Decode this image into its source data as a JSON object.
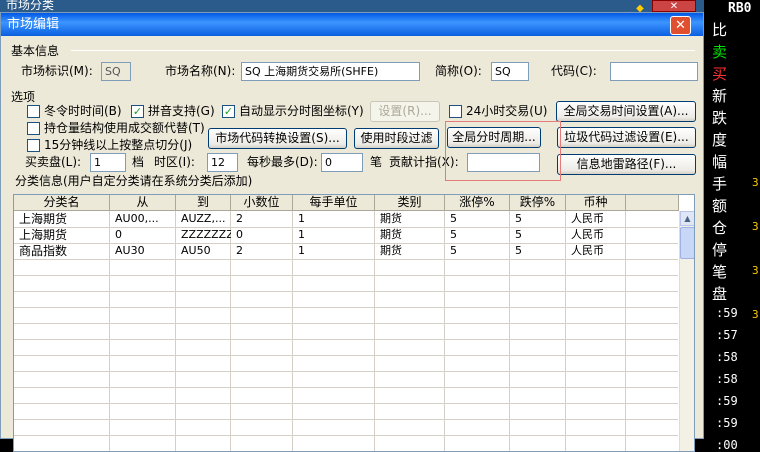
{
  "outer": {
    "title": "市场分类",
    "close": "✕"
  },
  "right_panel": {
    "header": "RB0",
    "side_chars": [
      {
        "t": "比",
        "c": "#ffffff"
      },
      {
        "t": "卖",
        "c": "#00e000"
      },
      {
        "t": "买",
        "c": "#ff3030"
      },
      {
        "t": "新",
        "c": "#ffffff"
      },
      {
        "t": "跌",
        "c": "#ffffff"
      },
      {
        "t": "度",
        "c": "#ffffff"
      },
      {
        "t": "幅",
        "c": "#ffffff"
      },
      {
        "t": "手",
        "c": "#ffffff"
      },
      {
        "t": "额",
        "c": "#ffffff"
      },
      {
        "t": "仓",
        "c": "#ffffff"
      },
      {
        "t": "停",
        "c": "#ffffff"
      },
      {
        "t": "笔",
        "c": "#ffffff"
      },
      {
        "t": "盘",
        "c": "#ffffff"
      }
    ],
    "values": [
      "3",
      "3",
      "3",
      "3"
    ],
    "times": [
      ":59",
      ":57",
      ":58",
      ":58",
      ":59",
      ":59",
      ":00"
    ]
  },
  "dialog": {
    "title": "市场编辑",
    "basic_section": "基本信息",
    "market_id_label": "市场标识(M):",
    "market_id_value": "SQ",
    "market_name_label": "市场名称(N):",
    "market_name_value": "SQ 上海期货交易所(SHFE)",
    "short_label": "简称(O):",
    "short_value": "SQ",
    "code_label": "代码(C):",
    "code_value": "",
    "options_section": "选项",
    "chk_winter": "冬令时时间(B)",
    "chk_pinyin": "拼音支持(G)",
    "chk_auto_axis": "自动显示分时图坐标(Y)",
    "btn_settings": "设置(R)...",
    "chk_24h": "24小时交易(U)",
    "btn_global_time": "全局交易时间设置(A)...",
    "chk_position": "持仓量结构使用成交额代替(T)",
    "chk_15min": "15分钟线以上按整点切分(J)",
    "btn_code_convert": "市场代码转换设置(S)...",
    "btn_time_filter": "使用时段过滤",
    "btn_global_period": "全局分时周期...",
    "btn_junk_filter": "垃圾代码过滤设置(E)...",
    "btn_info_path": "信息地雷路径(F)...",
    "bid_ask_label": "买卖盘(L):",
    "bid_ask_value": "1",
    "level_label": "档",
    "tz_label": "时区(I):",
    "tz_value": "12",
    "max_per_sec_label": "每秒最多(D):",
    "max_per_sec_value": "0",
    "bi_label": "笔",
    "contrib_label": "贡献计指(X):",
    "contrib_value": "",
    "class_section": "分类信息(用户自定分类请在系统分类后添加)",
    "columns": [
      "分类名",
      "从",
      "到",
      "小数位",
      "每手单位",
      "类别",
      "涨停%",
      "跌停%",
      "币种"
    ],
    "rows": [
      [
        "上海期货",
        "AU00,...",
        "AUZZ,...",
        "2",
        "1",
        "期货",
        "5",
        "5",
        "人民币"
      ],
      [
        "上海期货",
        "0",
        "ZZZZZZZZ",
        "0",
        "1",
        "期货",
        "5",
        "5",
        "人民币"
      ],
      [
        "商品指数",
        "AU30",
        "AU50",
        "2",
        "1",
        "期货",
        "5",
        "5",
        "人民币"
      ]
    ]
  },
  "colors": {
    "titlebar": "#0058e6",
    "dialog_bg": "#ece9d8",
    "highlight_box": "#e57a7a"
  }
}
